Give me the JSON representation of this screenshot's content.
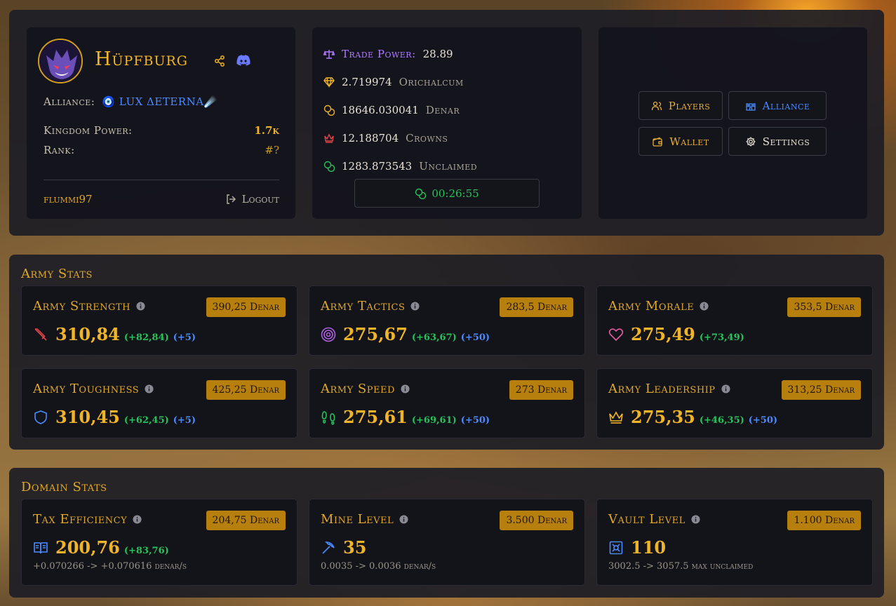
{
  "profile": {
    "kingdom_name": "Hüpfburg",
    "alliance_label": "Alliance:",
    "alliance_name": "🧿 LUX ΔETERNA☄️",
    "kingdom_power_label": "Kingdom Power:",
    "kingdom_power_value": "1.7k",
    "rank_label": "Rank:",
    "rank_value": "#?",
    "username": "flummi97",
    "logout_label": "Logout"
  },
  "resources": {
    "trade_power_label": "Trade Power:",
    "trade_power_value": "28.89",
    "items": [
      {
        "value": "2.719974",
        "name": "Orichalcum",
        "icon": "diamond-icon",
        "color": "#f0b429"
      },
      {
        "value": "18646.030041",
        "name": "Denar",
        "icon": "coins-icon",
        "color": "#f0b429"
      },
      {
        "value": "12.188704",
        "name": "Crowns",
        "icon": "crown-icon",
        "color": "#e0454a"
      },
      {
        "value": "1283.873543",
        "name": "Unclaimed",
        "icon": "coins-icon",
        "color": "#26c25a"
      }
    ],
    "claim_timer": "00:26:55"
  },
  "nav": {
    "players": "Players",
    "alliance": "Alliance",
    "wallet": "Wallet",
    "settings": "Settings"
  },
  "army": {
    "title": "Army Stats",
    "stats": [
      {
        "name": "Army Strength",
        "price": "390,25 Denar",
        "value": "310,84",
        "bonus": "(+82,84)",
        "extra": "(+5)",
        "icon": "sword-icon"
      },
      {
        "name": "Army Tactics",
        "price": "283,5 Denar",
        "value": "275,67",
        "bonus": "(+63,67)",
        "extra": "(+50)",
        "icon": "target-icon"
      },
      {
        "name": "Army Morale",
        "price": "353,5 Denar",
        "value": "275,49",
        "bonus": "(+73,49)",
        "extra": "",
        "icon": "heart-icon"
      },
      {
        "name": "Army Toughness",
        "price": "425,25 Denar",
        "value": "310,45",
        "bonus": "(+62,45)",
        "extra": "(+5)",
        "icon": "shield-icon"
      },
      {
        "name": "Army Speed",
        "price": "273 Denar",
        "value": "275,61",
        "bonus": "(+69,61)",
        "extra": "(+50)",
        "icon": "footprints-icon"
      },
      {
        "name": "Army Leadership",
        "price": "313,25 Denar",
        "value": "275,35",
        "bonus": "(+46,35)",
        "extra": "(+50)",
        "icon": "crown-icon"
      }
    ]
  },
  "domain": {
    "title": "Domain Stats",
    "stats": [
      {
        "name": "Tax Efficiency",
        "price": "204,75 Denar",
        "value": "200,76",
        "bonus": "(+83,76)",
        "sub": "+0.070266 -> +0.070616 denar/s",
        "icon": "book-icon"
      },
      {
        "name": "Mine Level",
        "price": "3.500 Denar",
        "value": "35",
        "bonus": "",
        "sub": "0.0035 -> 0.0036 denar/s",
        "icon": "pickaxe-icon"
      },
      {
        "name": "Vault Level",
        "price": "1.100 Denar",
        "value": "110",
        "bonus": "",
        "sub": "3002.5 -> 3057.5 max unclaimed",
        "icon": "vault-icon"
      }
    ]
  },
  "colors": {
    "gold": "#f0b429",
    "green": "#26c25a",
    "blue": "#4a8cff",
    "badge": "#b77f0e",
    "purple": "#b07bff"
  }
}
